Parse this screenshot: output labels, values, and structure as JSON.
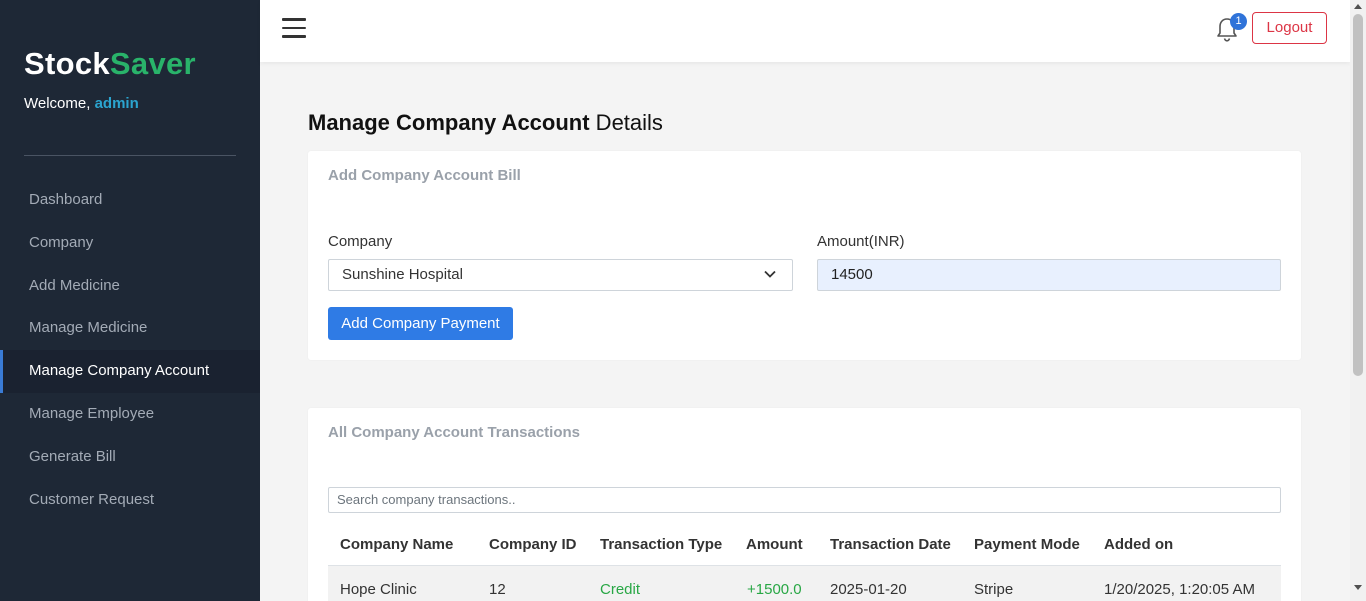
{
  "sidebar": {
    "brand_part1": "Stock",
    "brand_part2": "Saver",
    "welcome_text": "Welcome, ",
    "welcome_user": "admin",
    "items": [
      {
        "label": "Dashboard"
      },
      {
        "label": "Company"
      },
      {
        "label": "Add Medicine"
      },
      {
        "label": "Manage Medicine"
      },
      {
        "label": "Manage Company Account",
        "active": true
      },
      {
        "label": "Manage Employee"
      },
      {
        "label": "Generate Bill"
      },
      {
        "label": "Customer Request"
      }
    ]
  },
  "header": {
    "notification_count": "1",
    "logout_label": "Logout"
  },
  "page": {
    "title_bold": "Manage Company Account",
    "title_rest": " Details"
  },
  "add_form": {
    "card_title": "Add Company Account Bill",
    "company_label": "Company",
    "company_value": "Sunshine Hospital",
    "amount_label": "Amount(INR)",
    "amount_value": "14500",
    "submit_label": "Add Company Payment"
  },
  "transactions": {
    "card_title": "All Company Account Transactions",
    "search_placeholder": "Search company transactions..",
    "columns": [
      "Company Name",
      "Company ID",
      "Transaction Type",
      "Amount",
      "Transaction Date",
      "Payment Mode",
      "Added on"
    ],
    "rows": [
      [
        "Hope Clinic",
        "12",
        "Credit",
        "+1500.0",
        "2025-01-20",
        "Stripe",
        "1/20/2025, 1:20:05 AM"
      ]
    ]
  },
  "colors": {
    "sidebar_bg": "#1e2836",
    "brand_accent": "#29b36a",
    "primary": "#2f7be5",
    "danger": "#dc3545",
    "credit": "#28a745"
  }
}
